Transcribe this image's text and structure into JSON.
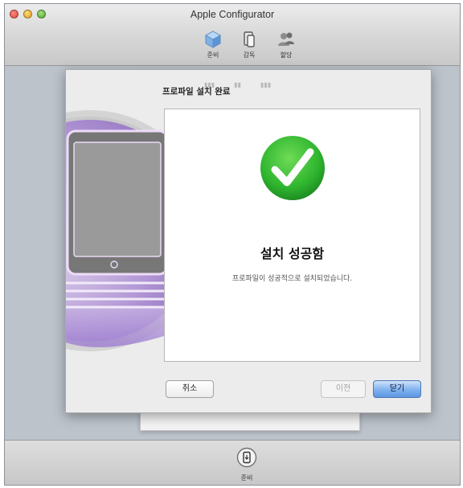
{
  "window": {
    "title": "Apple Configurator"
  },
  "toolbar": {
    "prepare": {
      "label": "준비",
      "icon": "cube-icon"
    },
    "supervise": {
      "label": "감독",
      "icon": "devices-icon"
    },
    "assign": {
      "label": "할당",
      "icon": "people-icon"
    }
  },
  "sheet": {
    "heading": "프로파일 설치 완료",
    "success_title": "설치 성공함",
    "success_message": "프로파일이 성공적으로 설치되었습니다.",
    "buttons": {
      "cancel": "취소",
      "previous": "이전",
      "close": "닫기"
    }
  },
  "bottom": {
    "prepare_label": "준비",
    "icon": "device-prepare-icon"
  },
  "colors": {
    "accent_blue": "#5c97e3",
    "success_green": "#2fb52f"
  }
}
